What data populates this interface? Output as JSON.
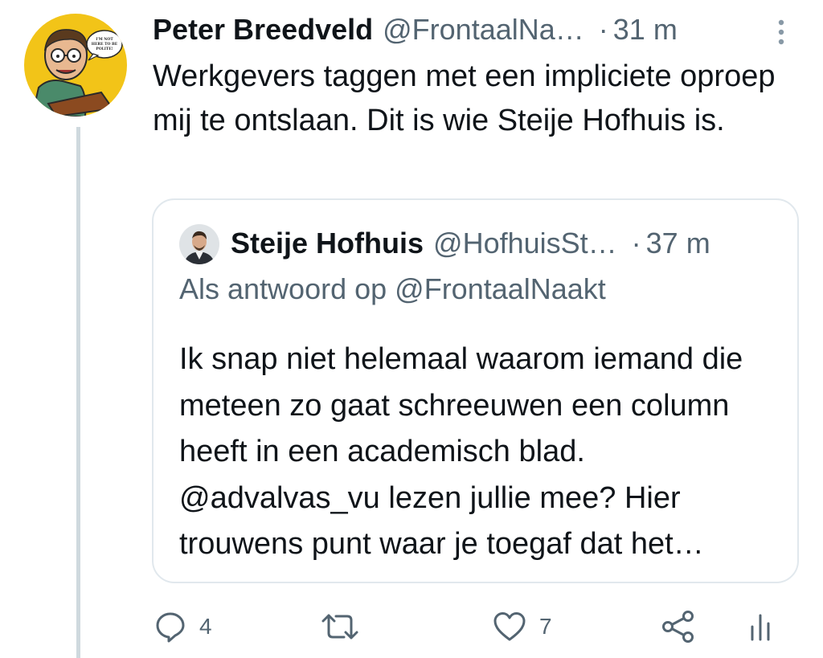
{
  "tweet": {
    "author_name": "Peter Breedveld",
    "author_handle": "@FrontaalNa…",
    "separator": "·",
    "time": "31 m",
    "text": "Werkgevers taggen met een impliciete oproep mij te ontslaan. Dit is wie Steije Hofhuis is.",
    "avatar_bubble_text": "I'M NOT HERE TO BE POLITE!"
  },
  "quoted_tweet": {
    "author_name": "Steije Hofhuis",
    "author_handle": "@HofhuisSt…",
    "separator": "·",
    "time": "37 m",
    "reply_to": "Als antwoord op @FrontaalNaakt",
    "text": "Ik snap niet helemaal waarom iemand die meteen zo gaat schreeuwen een column heeft in een academisch blad. @advalvas_vu lezen jullie mee? Hier trouwens punt waar je toegaf dat het…"
  },
  "actions": {
    "reply_count": "4",
    "retweet_count": "",
    "like_count": "7"
  },
  "icons": {
    "more": "more-vertical-icon",
    "reply": "reply-icon",
    "retweet": "retweet-icon",
    "like": "heart-icon",
    "share": "share-icon",
    "analytics": "analytics-icon"
  },
  "colors": {
    "text_primary": "#0f1419",
    "text_secondary": "#536471",
    "border": "#e1e8ed",
    "thread_line": "#cfd9de",
    "avatar_bg": "#f2c418"
  }
}
